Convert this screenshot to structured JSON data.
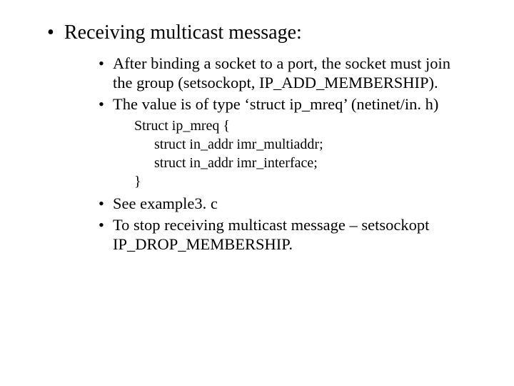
{
  "heading": "Receiving multicast message:",
  "sub": {
    "a": "After binding a socket to a port, the socket must join the group (setsockopt, IP_ADD_MEMBERSHIP).",
    "b": "The value is of type ‘struct ip_mreq’ (netinet/in. h)",
    "c": "See example3. c",
    "d": "To stop receiving multicast message – setsockopt IP_DROP_MEMBERSHIP."
  },
  "code": {
    "l1": "Struct ip_mreq {",
    "l2": "struct in_addr imr_multiaddr;",
    "l3": "struct in_addr imr_interface;",
    "l4": "}"
  }
}
